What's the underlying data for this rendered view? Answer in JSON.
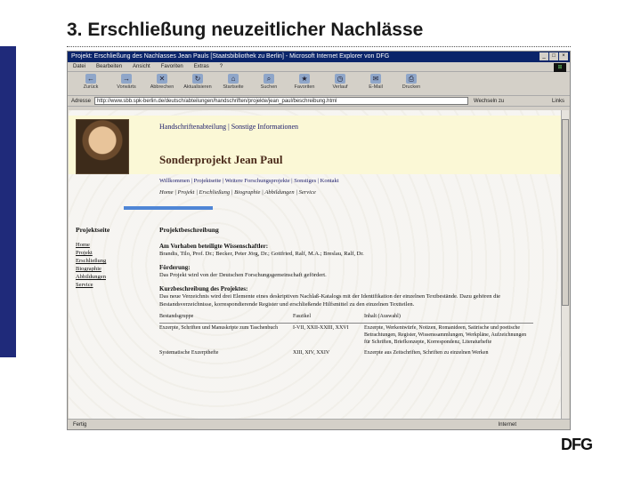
{
  "slide": {
    "title": "3. Erschließung neuzeitlicher Nachlässe",
    "logo": "DFG"
  },
  "browser": {
    "title": "Projekt: Erschließung des Nachlasses Jean Pauls [Staatsbibliothek zu Berlin] - Microsoft Internet Explorer von DFG",
    "menu": [
      "Datei",
      "Bearbeiten",
      "Ansicht",
      "Favoriten",
      "Extras",
      "?"
    ],
    "toolbar": [
      "Zurück",
      "Vorwärts",
      "Abbrechen",
      "Aktualisieren",
      "Startseite",
      "Suchen",
      "Favoriten",
      "Verlauf",
      "E-Mail",
      "Drucken"
    ],
    "address_label": "Adresse",
    "address_value": "http://www.sbb.spk-berlin.de/deutsch/abteilungen/handschriften/projekte/jean_paul/beschreibung.html",
    "go_label": "Wechseln zu",
    "links_label": "Links",
    "status": "Fertig",
    "zone": "Internet"
  },
  "page": {
    "header_links": [
      "Handschriftenabteilung",
      "Sonstige Informationen"
    ],
    "title": "Sonderprojekt Jean Paul",
    "nav1": "Willkommen | Projektseite | Weitere Forschungsprojekte | Sonstiges | Kontakt",
    "nav2": "Home | Projekt | Erschließung | Biographie | Abbildungen | Service",
    "sidebar_title": "Projektseite",
    "sidebar_items": [
      "Home",
      "Projekt",
      "Erschließung",
      "Biographie",
      "Abbildungen",
      "Service"
    ],
    "main_title": "Projektbeschreibung",
    "scientists_heading": "Am Vorhaben beteiligte Wissenschaftler:",
    "scientists": "Brandis, Tilo, Prof. Dr.; Becker, Peter Jörg, Dr.; Gottfried, Ralf, M.A.; Breslau, Ralf, Dr.",
    "funding_heading": "Förderung:",
    "funding": "Das Projekt wird von der Deutschen Forschungsgemeinschaft gefördert.",
    "summary_heading": "Kurzbeschreibung des Projektes:",
    "summary": "Das neue Verzeichnis wird drei Elemente eines deskriptiven Nachlaß-Katalogs mit der Identifikation der einzelnen Textbestände. Dazu gehören die Bestandsverzeichnisse, korrespondierende Register und erschließende Hilfsmittel zu den einzelnen Textteilen.",
    "table_headers": [
      "Bestandsgruppe",
      "Faszikel",
      "Inhalt (Auswahl)"
    ],
    "table_rows": [
      [
        "Exzerpte, Schriften und Manuskripte zum Taschenbuch",
        "I-VII, XXII-XXIII, XXVI",
        "Exzerpte, Werkentwürfe, Notizen, Romanideen, Satirische und poetische Betrachtungen, Register, Wissenssammlungen, Werkpläne, Aufzeichnungen für Schriften, Briefkonzepte, Korrespondenz, Literaturhefte"
      ],
      [
        "Systematische Exzerpthefte",
        "XIII, XIV, XXIV",
        "Exzerpte aus Zeitschriften, Schriften zu einzelnen Werken"
      ]
    ]
  }
}
